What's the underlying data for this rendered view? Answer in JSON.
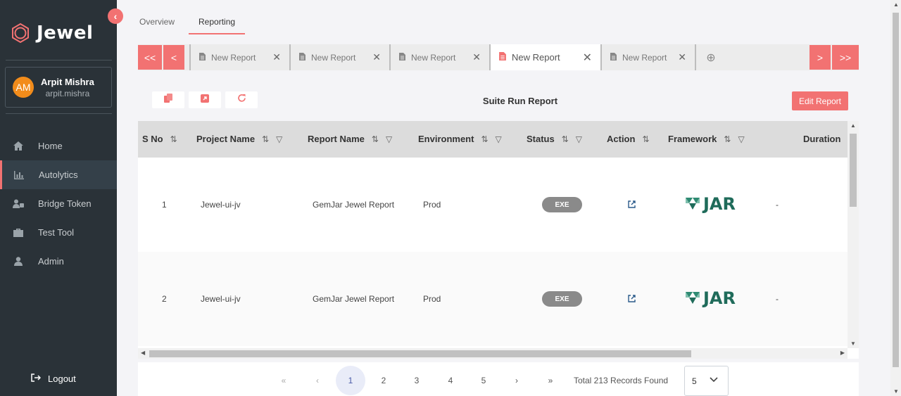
{
  "app": {
    "name": "Jewel"
  },
  "user": {
    "initials": "AM",
    "name": "Arpit Mishra",
    "handle": "arpit.mishra"
  },
  "sidebar": {
    "items": [
      {
        "label": "Home"
      },
      {
        "label": "Autolytics"
      },
      {
        "label": "Bridge Token"
      },
      {
        "label": "Test Tool"
      },
      {
        "label": "Admin"
      }
    ],
    "logout": "Logout"
  },
  "top_tabs": [
    {
      "label": "Overview"
    },
    {
      "label": "Reporting"
    }
  ],
  "report_tabs": [
    {
      "label": "New Report"
    },
    {
      "label": "New Report"
    },
    {
      "label": "New Report"
    },
    {
      "label": "New Report"
    },
    {
      "label": "New Report"
    }
  ],
  "report": {
    "title": "Suite Run Report",
    "edit_label": "Edit Report"
  },
  "table": {
    "columns": [
      "S No",
      "Project Name",
      "Report Name",
      "Environment",
      "Status",
      "Action",
      "Framework",
      "Duration"
    ],
    "rows": [
      {
        "sno": "1",
        "project": "Jewel-ui-jv",
        "report": "GemJar Jewel Report",
        "env": "Prod",
        "status": "EXE",
        "framework": "JAR",
        "duration": "-"
      },
      {
        "sno": "2",
        "project": "Jewel-ui-jv",
        "report": "GemJar Jewel Report",
        "env": "Prod",
        "status": "EXE",
        "framework": "JAR",
        "duration": "-"
      }
    ]
  },
  "pagination": {
    "pages": [
      "1",
      "2",
      "3",
      "4",
      "5"
    ],
    "records": "Total 213 Records Found",
    "per_page": "5"
  },
  "colors": {
    "accent": "#f27272",
    "sidebar": "#2a3238",
    "avatar": "#f28c1b",
    "jar": "#1f6b5a"
  }
}
